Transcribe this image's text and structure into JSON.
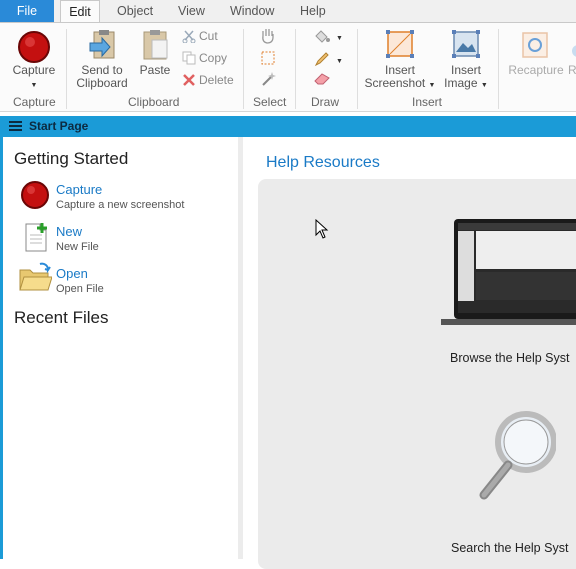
{
  "menu": {
    "file": "File",
    "edit": "Edit",
    "object": "Object",
    "view": "View",
    "window": "Window",
    "help": "Help"
  },
  "ribbon": {
    "capture_label": "Capture",
    "capture_group": "Capture",
    "send_to_clipboard": [
      "Send to",
      "Clipboard"
    ],
    "paste": "Paste",
    "cut": "Cut",
    "copy": "Copy",
    "delete": "Delete",
    "clipboard_group": "Clipboard",
    "select_group": "Select",
    "draw_group": "Draw",
    "insert_screenshot": [
      "Insert",
      "Screenshot"
    ],
    "insert_image": [
      "Insert",
      "Image"
    ],
    "insert_group": "Insert",
    "recapture": "Recapture",
    "cut_off": "R"
  },
  "start_page": {
    "title": "Start Page"
  },
  "getting_started": {
    "heading": "Getting Started",
    "items": [
      {
        "title": "Capture",
        "subtitle": "Capture a new screenshot"
      },
      {
        "title": "New",
        "subtitle": "New File"
      },
      {
        "title": "Open",
        "subtitle": "Open File"
      }
    ],
    "recent_heading": "Recent Files"
  },
  "help": {
    "title": "Help Resources",
    "browse": "Browse the Help Syst",
    "search": "Search the Help Syst"
  },
  "colors": {
    "accent": "#1b9bd7",
    "file_tab": "#2a8ad8",
    "link": "#1a7ac6",
    "capture_red": "#d01010"
  }
}
